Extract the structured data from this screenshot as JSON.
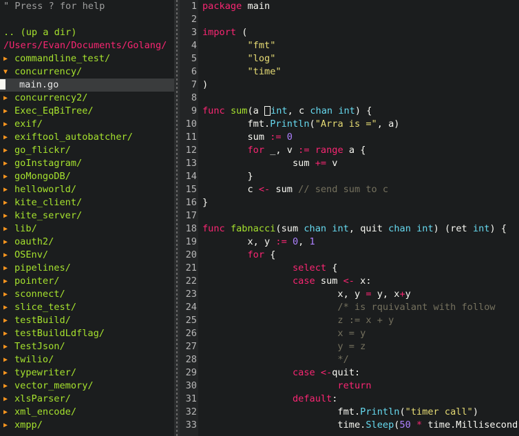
{
  "tree": {
    "help": "\" Press ? for help",
    "up_dir": ".. (up a dir)",
    "root": "/Users/Evan/Documents/Golang/",
    "items": [
      {
        "name": "commandline_test",
        "type": "dir",
        "open": false
      },
      {
        "name": "concurrency",
        "type": "dir",
        "open": true
      },
      {
        "name": "main.go",
        "type": "file",
        "selected": true
      },
      {
        "name": "concurrency2",
        "type": "dir",
        "open": false
      },
      {
        "name": "Exec_EqBiTree",
        "type": "dir",
        "open": false
      },
      {
        "name": "exif",
        "type": "dir",
        "open": false
      },
      {
        "name": "exiftool_autobatcher",
        "type": "dir",
        "open": false
      },
      {
        "name": "go_flickr",
        "type": "dir",
        "open": false
      },
      {
        "name": "goInstagram",
        "type": "dir",
        "open": false
      },
      {
        "name": "goMongoDB",
        "type": "dir",
        "open": false
      },
      {
        "name": "helloworld",
        "type": "dir",
        "open": false
      },
      {
        "name": "kite_client",
        "type": "dir",
        "open": false
      },
      {
        "name": "kite_server",
        "type": "dir",
        "open": false
      },
      {
        "name": "lib",
        "type": "dir",
        "open": false
      },
      {
        "name": "oauth2",
        "type": "dir",
        "open": false
      },
      {
        "name": "OSEnv",
        "type": "dir",
        "open": false
      },
      {
        "name": "pipelines",
        "type": "dir",
        "open": false
      },
      {
        "name": "pointer",
        "type": "dir",
        "open": false
      },
      {
        "name": "sconnect",
        "type": "dir",
        "open": false
      },
      {
        "name": "slice_test",
        "type": "dir",
        "open": false
      },
      {
        "name": "testBuild",
        "type": "dir",
        "open": false
      },
      {
        "name": "testBuildLdflag",
        "type": "dir",
        "open": false
      },
      {
        "name": "TestJson",
        "type": "dir",
        "open": false
      },
      {
        "name": "twilio",
        "type": "dir",
        "open": false
      },
      {
        "name": "typewriter",
        "type": "dir",
        "open": false
      },
      {
        "name": "vector_memory",
        "type": "dir",
        "open": false
      },
      {
        "name": "xlsParser",
        "type": "dir",
        "open": false
      },
      {
        "name": "xml_encode",
        "type": "dir",
        "open": false
      },
      {
        "name": "xmpp",
        "type": "dir",
        "open": false
      }
    ]
  },
  "editor": {
    "lines": [
      [
        [
          "kw",
          "package"
        ],
        [
          "pl",
          " main"
        ]
      ],
      [],
      [
        [
          "kw",
          "import"
        ],
        [
          "pl",
          " ("
        ]
      ],
      [
        [
          "pl",
          "        "
        ],
        [
          "st",
          "\"fmt\""
        ]
      ],
      [
        [
          "pl",
          "        "
        ],
        [
          "st",
          "\"log\""
        ]
      ],
      [
        [
          "pl",
          "        "
        ],
        [
          "st",
          "\"time\""
        ]
      ],
      [
        [
          "pl",
          ")"
        ]
      ],
      [],
      [
        [
          "kw",
          "func"
        ],
        [
          "pl",
          " "
        ],
        [
          "fn",
          "sum"
        ],
        [
          "pl",
          "(a "
        ],
        [
          "box",
          ""
        ],
        [
          "bt",
          "int"
        ],
        [
          "pl",
          ", c "
        ],
        [
          "bt",
          "chan"
        ],
        [
          "pl",
          " "
        ],
        [
          "bt",
          "int"
        ],
        [
          "pl",
          ") {"
        ]
      ],
      [
        [
          "pl",
          "        fmt."
        ],
        [
          "bt",
          "Println"
        ],
        [
          "pl",
          "("
        ],
        [
          "st",
          "\"Arra is =\""
        ],
        [
          "pl",
          ", a)"
        ]
      ],
      [
        [
          "pl",
          "        sum "
        ],
        [
          "op",
          ":="
        ],
        [
          "pl",
          " "
        ],
        [
          "num",
          "0"
        ]
      ],
      [
        [
          "pl",
          "        "
        ],
        [
          "kw",
          "for"
        ],
        [
          "pl",
          " _, v "
        ],
        [
          "op",
          ":="
        ],
        [
          "pl",
          " "
        ],
        [
          "kw",
          "range"
        ],
        [
          "pl",
          " a {"
        ]
      ],
      [
        [
          "pl",
          "                sum "
        ],
        [
          "op",
          "+="
        ],
        [
          "pl",
          " v"
        ]
      ],
      [
        [
          "pl",
          "        }"
        ]
      ],
      [
        [
          "pl",
          "        c "
        ],
        [
          "op",
          "<-"
        ],
        [
          "pl",
          " sum "
        ],
        [
          "cm",
          "// send sum to c"
        ]
      ],
      [
        [
          "pl",
          "}"
        ]
      ],
      [],
      [
        [
          "kw",
          "func"
        ],
        [
          "pl",
          " "
        ],
        [
          "fn",
          "fabnacci"
        ],
        [
          "pl",
          "(sum "
        ],
        [
          "bt",
          "chan"
        ],
        [
          "pl",
          " "
        ],
        [
          "bt",
          "int"
        ],
        [
          "pl",
          ", quit "
        ],
        [
          "bt",
          "chan"
        ],
        [
          "pl",
          " "
        ],
        [
          "bt",
          "int"
        ],
        [
          "pl",
          ") (ret "
        ],
        [
          "bt",
          "int"
        ],
        [
          "pl",
          ") {"
        ]
      ],
      [
        [
          "pl",
          "        x, y "
        ],
        [
          "op",
          ":="
        ],
        [
          "pl",
          " "
        ],
        [
          "num",
          "0"
        ],
        [
          "pl",
          ", "
        ],
        [
          "num",
          "1"
        ]
      ],
      [
        [
          "pl",
          "        "
        ],
        [
          "kw",
          "for"
        ],
        [
          "pl",
          " {"
        ]
      ],
      [
        [
          "pl",
          "                "
        ],
        [
          "kw",
          "select"
        ],
        [
          "pl",
          " {"
        ]
      ],
      [
        [
          "pl",
          "                "
        ],
        [
          "kw",
          "case"
        ],
        [
          "pl",
          " sum "
        ],
        [
          "op",
          "<-"
        ],
        [
          "pl",
          " x:"
        ]
      ],
      [
        [
          "pl",
          "                        x, y "
        ],
        [
          "op",
          "="
        ],
        [
          "pl",
          " y, x"
        ],
        [
          "op",
          "+"
        ],
        [
          "pl",
          "y"
        ]
      ],
      [
        [
          "pl",
          "                        "
        ],
        [
          "cm",
          "/* is rquivalant with follow"
        ]
      ],
      [
        [
          "cm",
          "                        z := x + y"
        ]
      ],
      [
        [
          "cm",
          "                        x = y"
        ]
      ],
      [
        [
          "cm",
          "                        y = z"
        ]
      ],
      [
        [
          "cm",
          "                        */"
        ]
      ],
      [
        [
          "pl",
          "                "
        ],
        [
          "kw",
          "case"
        ],
        [
          "pl",
          " "
        ],
        [
          "op",
          "<-"
        ],
        [
          "pl",
          "quit:"
        ]
      ],
      [
        [
          "pl",
          "                        "
        ],
        [
          "kw",
          "return"
        ]
      ],
      [
        [
          "pl",
          "                "
        ],
        [
          "kw",
          "default"
        ],
        [
          "pl",
          ":"
        ]
      ],
      [
        [
          "pl",
          "                        fmt."
        ],
        [
          "bt",
          "Println"
        ],
        [
          "pl",
          "("
        ],
        [
          "st",
          "\"timer call\""
        ],
        [
          "pl",
          ")"
        ]
      ],
      [
        [
          "pl",
          "                        time."
        ],
        [
          "bt",
          "Sleep"
        ],
        [
          "pl",
          "("
        ],
        [
          "num",
          "50"
        ],
        [
          "pl",
          " "
        ],
        [
          "op",
          "*"
        ],
        [
          "pl",
          " time.Millisecond)"
        ]
      ]
    ]
  },
  "colors": {
    "background": "#1b1d1e",
    "keyword": "#f92672",
    "builtin": "#66d9ef",
    "string": "#e6db74",
    "number": "#ae81ff",
    "comment": "#75715e",
    "directory": "#a6e22e",
    "root_path": "#f92672",
    "arrow": "#fd971f"
  },
  "icons": {
    "closed_dir": "triangle-right-icon",
    "open_dir": "triangle-down-icon",
    "file_cursor": "cursor-block-icon"
  }
}
